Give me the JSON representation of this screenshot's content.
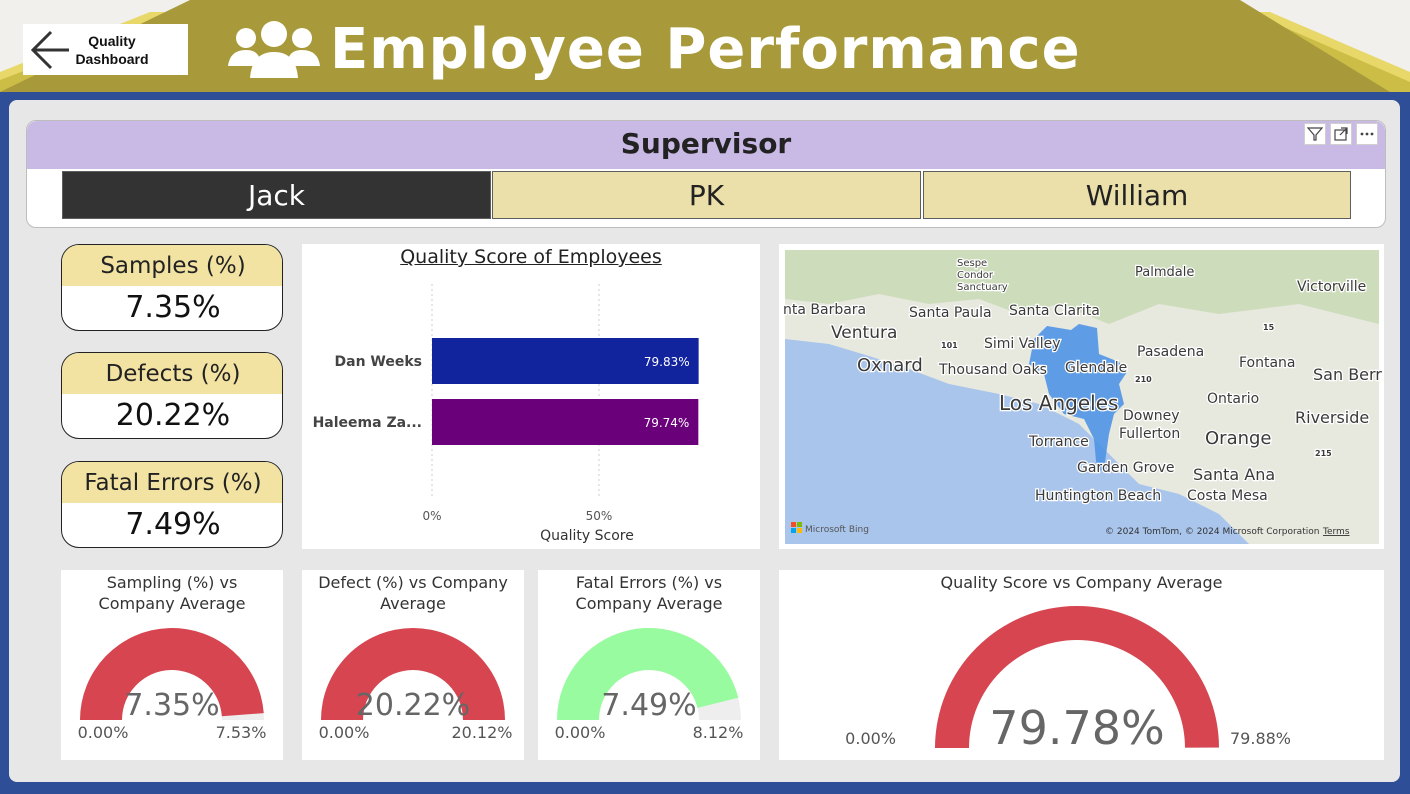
{
  "header": {
    "back_label_line1": "Quality",
    "back_label_line2": "Dashboard",
    "title": "Employee Performance",
    "icon": "people-group-icon"
  },
  "slicer": {
    "title": "Supervisor",
    "options": [
      {
        "label": "Jack",
        "selected": true
      },
      {
        "label": "PK",
        "selected": false
      },
      {
        "label": "William",
        "selected": false
      }
    ]
  },
  "kpis": [
    {
      "title": "Samples (%)",
      "value": "7.35%"
    },
    {
      "title": "Defects (%)",
      "value": "20.22%"
    },
    {
      "title": "Fatal Errors (%)",
      "value": "7.49%"
    }
  ],
  "bar_chart": {
    "title": "Quality Score of Employees",
    "xlabel": "Quality Score",
    "ticks": [
      "0%",
      "50%"
    ]
  },
  "chart_data": [
    {
      "type": "bar",
      "orientation": "horizontal",
      "title": "Quality Score of Employees",
      "xlabel": "Quality Score",
      "ylabel": "",
      "xlim": [
        0,
        100
      ],
      "categories": [
        "Dan Weeks",
        "Haleema Za..."
      ],
      "values": [
        79.83,
        79.74
      ],
      "data_labels": [
        "79.83%",
        "79.74%"
      ],
      "colors": [
        "#12239e",
        "#6b007b"
      ],
      "grid": true
    },
    {
      "type": "gauge",
      "title": "Sampling (%) vs Company Average",
      "value": 7.35,
      "value_label": "7.35%",
      "min": 0,
      "min_label": "0.00%",
      "max": 7.53,
      "max_label": "7.53%",
      "color": "#d64550"
    },
    {
      "type": "gauge",
      "title": "Defect (%) vs Company Average",
      "value": 20.22,
      "value_label": "20.22%",
      "min": 0,
      "min_label": "0.00%",
      "max": 20.12,
      "max_label": "20.12%",
      "color": "#d64550"
    },
    {
      "type": "gauge",
      "title": "Fatal Errors (%) vs Company Average",
      "value": 7.49,
      "value_label": "7.49%",
      "min": 0,
      "min_label": "0.00%",
      "max": 8.12,
      "max_label": "8.12%",
      "color": "#99fb9f"
    },
    {
      "type": "gauge",
      "title": "Quality Score vs Company Average",
      "value": 79.78,
      "value_label": "79.78%",
      "min": 0,
      "min_label": "0.00%",
      "max": 79.88,
      "max_label": "79.88%",
      "color": "#d64550"
    }
  ],
  "map": {
    "labels": [
      "Sespe",
      "Condor",
      "Sanctuary",
      "Palmdale",
      "Victorville",
      "nta Barbara",
      "Ventura",
      "Santa Paula",
      "Santa Clarita",
      "Oxnard",
      "Simi Valley",
      "Pasadena",
      "Fontana",
      "Thousand Oaks",
      "Glendale",
      "San Berr",
      "Los Angeles",
      "Ontario",
      "Downey",
      "Riverside",
      "Torrance",
      "Fullerton",
      "Orange",
      "Garden Grove",
      "Santa Ana",
      "Huntington Beach",
      "Costa Mesa",
      "101",
      "15",
      "210",
      "215"
    ],
    "logo": "Microsoft Bing",
    "copyright": "© 2024 TomTom, © 2024 Microsoft Corporation",
    "terms": "Terms"
  },
  "visual_icons": [
    "filter-icon",
    "focus-mode-icon",
    "more-options-icon"
  ],
  "colors": {
    "banner": "#a89a3a",
    "frame": "#2e4f97",
    "slicer_header": "#c8b9e5",
    "card_header": "#f2e3a3",
    "selected": "#333333",
    "unselected": "#ebe0a9"
  }
}
